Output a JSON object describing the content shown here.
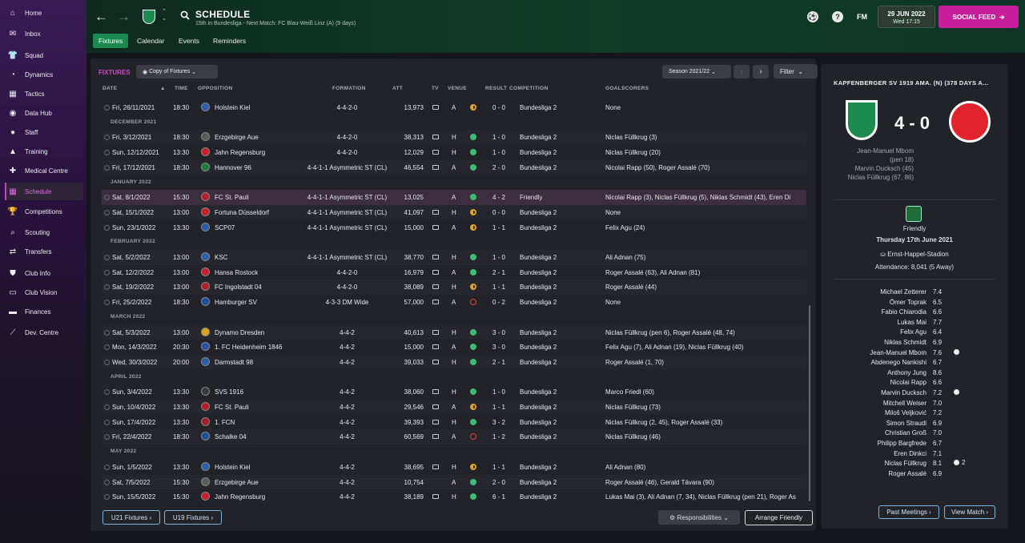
{
  "sidebar": {
    "items": [
      {
        "label": "Home",
        "icon": "home-icon",
        "glyph": "⌂",
        "active": false
      },
      {
        "label": "Inbox",
        "icon": "inbox-icon",
        "glyph": "✉",
        "active": false
      },
      {
        "label": "Squad",
        "icon": "shirt-icon",
        "glyph": "👕",
        "active": false
      },
      {
        "label": "Dynamics",
        "icon": "dynamics-icon",
        "glyph": "◔",
        "active": false
      },
      {
        "label": "Tactics",
        "icon": "tactics-icon",
        "glyph": "▦",
        "active": false
      },
      {
        "label": "Data Hub",
        "icon": "data-hub-icon",
        "glyph": "◉",
        "active": false
      },
      {
        "label": "Staff",
        "icon": "staff-icon",
        "glyph": "●",
        "active": false
      },
      {
        "label": "Training",
        "icon": "training-icon",
        "glyph": "▲",
        "active": false
      },
      {
        "label": "Medical Centre",
        "icon": "medical-icon",
        "glyph": "✚",
        "active": false
      },
      {
        "label": "Schedule",
        "icon": "calendar-icon",
        "glyph": "▦",
        "active": true
      },
      {
        "label": "Competitions",
        "icon": "trophy-icon",
        "glyph": "🏆",
        "active": false
      },
      {
        "label": "Scouting",
        "icon": "scouting-icon",
        "glyph": "⌕",
        "active": false
      },
      {
        "label": "Transfers",
        "icon": "transfers-icon",
        "glyph": "⇄",
        "active": false
      },
      {
        "label": "Club Info",
        "icon": "club-info-icon",
        "glyph": "⛊",
        "active": false
      },
      {
        "label": "Club Vision",
        "icon": "club-vision-icon",
        "glyph": "▭",
        "active": false
      },
      {
        "label": "Finances",
        "icon": "finances-icon",
        "glyph": "▬",
        "active": false
      },
      {
        "label": "Dev. Centre",
        "icon": "dev-centre-icon",
        "glyph": "⟋",
        "active": false
      }
    ]
  },
  "header": {
    "title": "SCHEDULE",
    "subtitle": "15th in Bundesliga - Next Match: FC Blau-Weiß Linz (A) (9 days)",
    "fm_label": "FM",
    "date": "29 JUN 2022",
    "time": "Wed 17:15",
    "social_feed": "SOCIAL FEED"
  },
  "tabs": [
    {
      "label": "Fixtures",
      "active": true
    },
    {
      "label": "Calendar",
      "active": false
    },
    {
      "label": "Events",
      "active": false
    },
    {
      "label": "Reminders",
      "active": false
    }
  ],
  "fixtures_panel": {
    "title": "FIXTURES",
    "view_dropdown": "Copy of Fixtures",
    "season": "Season 2021/22",
    "filter": "Filter",
    "columns": {
      "date": "DATE",
      "time": "TIME",
      "opposition": "OPPOSITION",
      "formation": "FORMATION",
      "att": "ATT",
      "tv": "TV",
      "venue": "VENUE",
      "result": "RESULT",
      "competition": "COMPETITION",
      "goalscorers": "GOALSCORERS"
    },
    "rows": [
      {
        "type": "match",
        "date": "Fri, 26/11/2021",
        "time": "18:30",
        "opp": "Holstein Kiel",
        "crest": "#2b5ea8",
        "formation": "4-4-2-0",
        "att": "13,973",
        "tv": true,
        "venue": "A",
        "res": "D",
        "score": "0 - 0",
        "comp": "Bundesliga 2",
        "scorers": "None"
      },
      {
        "type": "month",
        "label": "DECEMBER 2021"
      },
      {
        "type": "match",
        "date": "Fri, 3/12/2021",
        "time": "18:30",
        "opp": "Erzgebirge Aue",
        "crest": "#5a5a5a",
        "formation": "4-4-2-0",
        "att": "38,313",
        "tv": true,
        "venue": "H",
        "res": "W",
        "score": "1 - 0",
        "comp": "Bundesliga 2",
        "scorers": "Niclas Füllkrug (3)"
      },
      {
        "type": "match",
        "date": "Sun, 12/12/2021",
        "time": "13:30",
        "opp": "Jahn Regensburg",
        "crest": "#c8202a",
        "formation": "4-4-2-0",
        "att": "12,029",
        "tv": true,
        "venue": "H",
        "res": "W",
        "score": "1 - 0",
        "comp": "Bundesliga 2",
        "scorers": "Niclas Füllkrug (20)"
      },
      {
        "type": "match",
        "date": "Fri, 17/12/2021",
        "time": "18:30",
        "opp": "Hannover 96",
        "crest": "#1f7a3d",
        "formation": "4-4-1-1 Asymmetric ST (CL)",
        "att": "46,554",
        "tv": true,
        "venue": "A",
        "res": "W",
        "score": "2 - 0",
        "comp": "Bundesliga 2",
        "scorers": "Nicolai Rapp (50), Roger Assalé (70)"
      },
      {
        "type": "month",
        "label": "JANUARY 2022"
      },
      {
        "type": "match",
        "date": "Sat, 8/1/2022",
        "time": "15:30",
        "opp": "FC St. Pauli",
        "crest": "#b3202a",
        "formation": "4-4-1-1 Asymmetric ST (CL)",
        "att": "13,025",
        "tv": false,
        "venue": "A",
        "res": "W",
        "score": "4 - 2",
        "comp": "Friendly",
        "scorers": "Nicolai Rapp (3), Niclas Füllkrug (5), Niklas Schmidt (43), Eren Di",
        "hl": true
      },
      {
        "type": "match",
        "date": "Sat, 15/1/2022",
        "time": "13:00",
        "opp": "Fortuna Düsseldorf",
        "crest": "#c8202a",
        "formation": "4-4-1-1 Asymmetric ST (CL)",
        "att": "41,097",
        "tv": true,
        "venue": "H",
        "res": "D",
        "score": "0 - 0",
        "comp": "Bundesliga 2",
        "scorers": "None"
      },
      {
        "type": "match",
        "date": "Sun, 23/1/2022",
        "time": "13:30",
        "opp": "SCP07",
        "crest": "#2b5ea8",
        "formation": "4-4-1-1 Asymmetric ST (CL)",
        "att": "15,000",
        "tv": true,
        "venue": "A",
        "res": "D",
        "score": "1 - 1",
        "comp": "Bundesliga 2",
        "scorers": "Felix Agu (24)"
      },
      {
        "type": "month",
        "label": "FEBRUARY 2022"
      },
      {
        "type": "match",
        "date": "Sat, 5/2/2022",
        "time": "13:00",
        "opp": "KSC",
        "crest": "#2b5ea8",
        "formation": "4-4-1-1 Asymmetric ST (CL)",
        "att": "38,770",
        "tv": true,
        "venue": "H",
        "res": "W",
        "score": "1 - 0",
        "comp": "Bundesliga 2",
        "scorers": "Ali Adnan (75)"
      },
      {
        "type": "match",
        "date": "Sat, 12/2/2022",
        "time": "13:00",
        "opp": "Hansa Rostock",
        "crest": "#c8202a",
        "formation": "4-4-2-0",
        "att": "16,979",
        "tv": true,
        "venue": "A",
        "res": "W",
        "score": "2 - 1",
        "comp": "Bundesliga 2",
        "scorers": "Roger Assalé (63), Ali Adnan (81)"
      },
      {
        "type": "match",
        "date": "Sat, 19/2/2022",
        "time": "13:00",
        "opp": "FC Ingolstadt 04",
        "crest": "#b3202a",
        "formation": "4-4-2-0",
        "att": "38,089",
        "tv": true,
        "venue": "H",
        "res": "D",
        "score": "1 - 1",
        "comp": "Bundesliga 2",
        "scorers": "Roger Assalé (44)"
      },
      {
        "type": "match",
        "date": "Fri, 25/2/2022",
        "time": "18:30",
        "opp": "Hamburger SV",
        "crest": "#1d4f9a",
        "formation": "4-3-3 DM Wide",
        "att": "57,000",
        "tv": true,
        "venue": "A",
        "res": "L",
        "score": "0 - 2",
        "comp": "Bundesliga 2",
        "scorers": "None"
      },
      {
        "type": "month",
        "label": "MARCH 2022"
      },
      {
        "type": "match",
        "date": "Sat, 5/3/2022",
        "time": "13:00",
        "opp": "Dynamo Dresden",
        "crest": "#d9a21a",
        "formation": "4-4-2",
        "att": "40,613",
        "tv": true,
        "venue": "H",
        "res": "W",
        "score": "3 - 0",
        "comp": "Bundesliga 2",
        "scorers": "Niclas Füllkrug (pen 6), Roger Assalé (48, 74)"
      },
      {
        "type": "match",
        "date": "Mon, 14/3/2022",
        "time": "20:30",
        "opp": "1. FC Heidenheim 1846",
        "crest": "#2b4ea0",
        "formation": "4-4-2",
        "att": "15,000",
        "tv": true,
        "venue": "A",
        "res": "W",
        "score": "3 - 0",
        "comp": "Bundesliga 2",
        "scorers": "Felix Agu (7), Ali Adnan (19), Niclas Füllkrug (40)"
      },
      {
        "type": "match",
        "date": "Wed, 30/3/2022",
        "time": "20:00",
        "opp": "Darmstadt 98",
        "crest": "#2b5ea8",
        "formation": "4-4-2",
        "att": "39,033",
        "tv": true,
        "venue": "H",
        "res": "W",
        "score": "2 - 1",
        "comp": "Bundesliga 2",
        "scorers": "Roger Assalé (1, 70)"
      },
      {
        "type": "month",
        "label": "APRIL 2022"
      },
      {
        "type": "match",
        "date": "Sun, 3/4/2022",
        "time": "13:30",
        "opp": "SVS 1916",
        "crest": "#3a3a3a",
        "formation": "4-4-2",
        "att": "38,060",
        "tv": true,
        "venue": "H",
        "res": "W",
        "score": "1 - 0",
        "comp": "Bundesliga 2",
        "scorers": "Marco Friedl (60)"
      },
      {
        "type": "match",
        "date": "Sun, 10/4/2022",
        "time": "13:30",
        "opp": "FC St. Pauli",
        "crest": "#b3202a",
        "formation": "4-4-2",
        "att": "29,546",
        "tv": true,
        "venue": "A",
        "res": "D",
        "score": "1 - 1",
        "comp": "Bundesliga 2",
        "scorers": "Niclas Füllkrug (73)"
      },
      {
        "type": "match",
        "date": "Sun, 17/4/2022",
        "time": "13:30",
        "opp": "1. FCN",
        "crest": "#a3202a",
        "formation": "4-4-2",
        "att": "39,393",
        "tv": true,
        "venue": "H",
        "res": "W",
        "score": "3 - 2",
        "comp": "Bundesliga 2",
        "scorers": "Niclas Füllkrug (2, 45), Roger Assalé (33)"
      },
      {
        "type": "match",
        "date": "Fri, 22/4/2022",
        "time": "18:30",
        "opp": "Schalke 04",
        "crest": "#1d4f9a",
        "formation": "4-4-2",
        "att": "60,569",
        "tv": true,
        "venue": "A",
        "res": "L",
        "score": "1 - 2",
        "comp": "Bundesliga 2",
        "scorers": "Niclas Füllkrug (46)"
      },
      {
        "type": "month",
        "label": "MAY 2022"
      },
      {
        "type": "match",
        "date": "Sun, 1/5/2022",
        "time": "13:30",
        "opp": "Holstein Kiel",
        "crest": "#2b5ea8",
        "formation": "4-4-2",
        "att": "38,695",
        "tv": true,
        "venue": "H",
        "res": "D",
        "score": "1 - 1",
        "comp": "Bundesliga 2",
        "scorers": "Ali Adnan (80)"
      },
      {
        "type": "match",
        "date": "Sat, 7/5/2022",
        "time": "15:30",
        "opp": "Erzgebirge Aue",
        "crest": "#5a5a5a",
        "formation": "4-4-2",
        "att": "10,754",
        "tv": false,
        "venue": "A",
        "res": "W",
        "score": "2 - 0",
        "comp": "Bundesliga 2",
        "scorers": "Roger Assalé (46), Gerald Távara (90)"
      },
      {
        "type": "match",
        "date": "Sun, 15/5/2022",
        "time": "15:30",
        "opp": "Jahn Regensburg",
        "crest": "#c8202a",
        "formation": "4-4-2",
        "att": "38,189",
        "tv": true,
        "venue": "H",
        "res": "W",
        "score": "6 - 1",
        "comp": "Bundesliga 2",
        "scorers": "Lukas Mai (3), Ali Adnan (7, 34), Niclas Füllkrug (pen 21), Roger As"
      }
    ],
    "u21": "U21 Fixtures",
    "u19": "U19 Fixtures",
    "responsibilities": "Responsibilities",
    "arrange_friendly": "Arrange Friendly"
  },
  "match_panel": {
    "title": "KAPFENBERGER SV 1919 AMA. (N) (378 DAYS A...",
    "score": "4 - 0",
    "scorers": [
      "Jean-Manuel Mbom",
      "(pen 18)",
      "Marvin Ducksch (45)",
      "Niclas Füllkrug (67, 86)"
    ],
    "competition": "Friendly",
    "date": "Thursday 17th June 2021",
    "stadium": "Ernst-Happel-Stadion",
    "attendance": "Attendance: 8,041 (5 Away)",
    "players": [
      {
        "name": "Michael Zetterer",
        "rating": "7.4",
        "ball": false,
        "goals": ""
      },
      {
        "name": "Ömer Toprak",
        "rating": "6.5",
        "ball": false,
        "goals": ""
      },
      {
        "name": "Fabio Chiarodia",
        "rating": "6.6",
        "ball": false,
        "goals": ""
      },
      {
        "name": "Lukas Mai",
        "rating": "7.7",
        "ball": false,
        "goals": ""
      },
      {
        "name": "Felix Agu",
        "rating": "6.4",
        "ball": false,
        "goals": ""
      },
      {
        "name": "Niklas Schmidt",
        "rating": "6.9",
        "ball": false,
        "goals": ""
      },
      {
        "name": "Jean-Manuel Mbom",
        "rating": "7.6",
        "ball": true,
        "goals": ""
      },
      {
        "name": "Abdenego Nankishi",
        "rating": "6.7",
        "ball": false,
        "goals": ""
      },
      {
        "name": "Anthony Jung",
        "rating": "8.6",
        "ball": false,
        "goals": ""
      },
      {
        "name": "Nicolai Rapp",
        "rating": "6.6",
        "ball": false,
        "goals": ""
      },
      {
        "name": "Marvin Ducksch",
        "rating": "7.2",
        "ball": true,
        "goals": ""
      },
      {
        "name": "Mitchell Weiser",
        "rating": "7.0",
        "ball": false,
        "goals": ""
      },
      {
        "name": "Miloš Veljković",
        "rating": "7.2",
        "ball": false,
        "goals": ""
      },
      {
        "name": "Simon Straudi",
        "rating": "6.9",
        "ball": false,
        "goals": ""
      },
      {
        "name": "Christian Groß",
        "rating": "7.0",
        "ball": false,
        "goals": ""
      },
      {
        "name": "Philipp Bargfrede",
        "rating": "6.7",
        "ball": false,
        "goals": ""
      },
      {
        "name": "Eren Dinkci",
        "rating": "7.1",
        "ball": false,
        "goals": ""
      },
      {
        "name": "Niclas Füllkrug",
        "rating": "8.1",
        "ball": true,
        "goals": "2"
      },
      {
        "name": "Roger Assalé",
        "rating": "6.9",
        "ball": false,
        "goals": ""
      }
    ],
    "past_meetings": "Past Meetings",
    "view_match": "View Match"
  }
}
